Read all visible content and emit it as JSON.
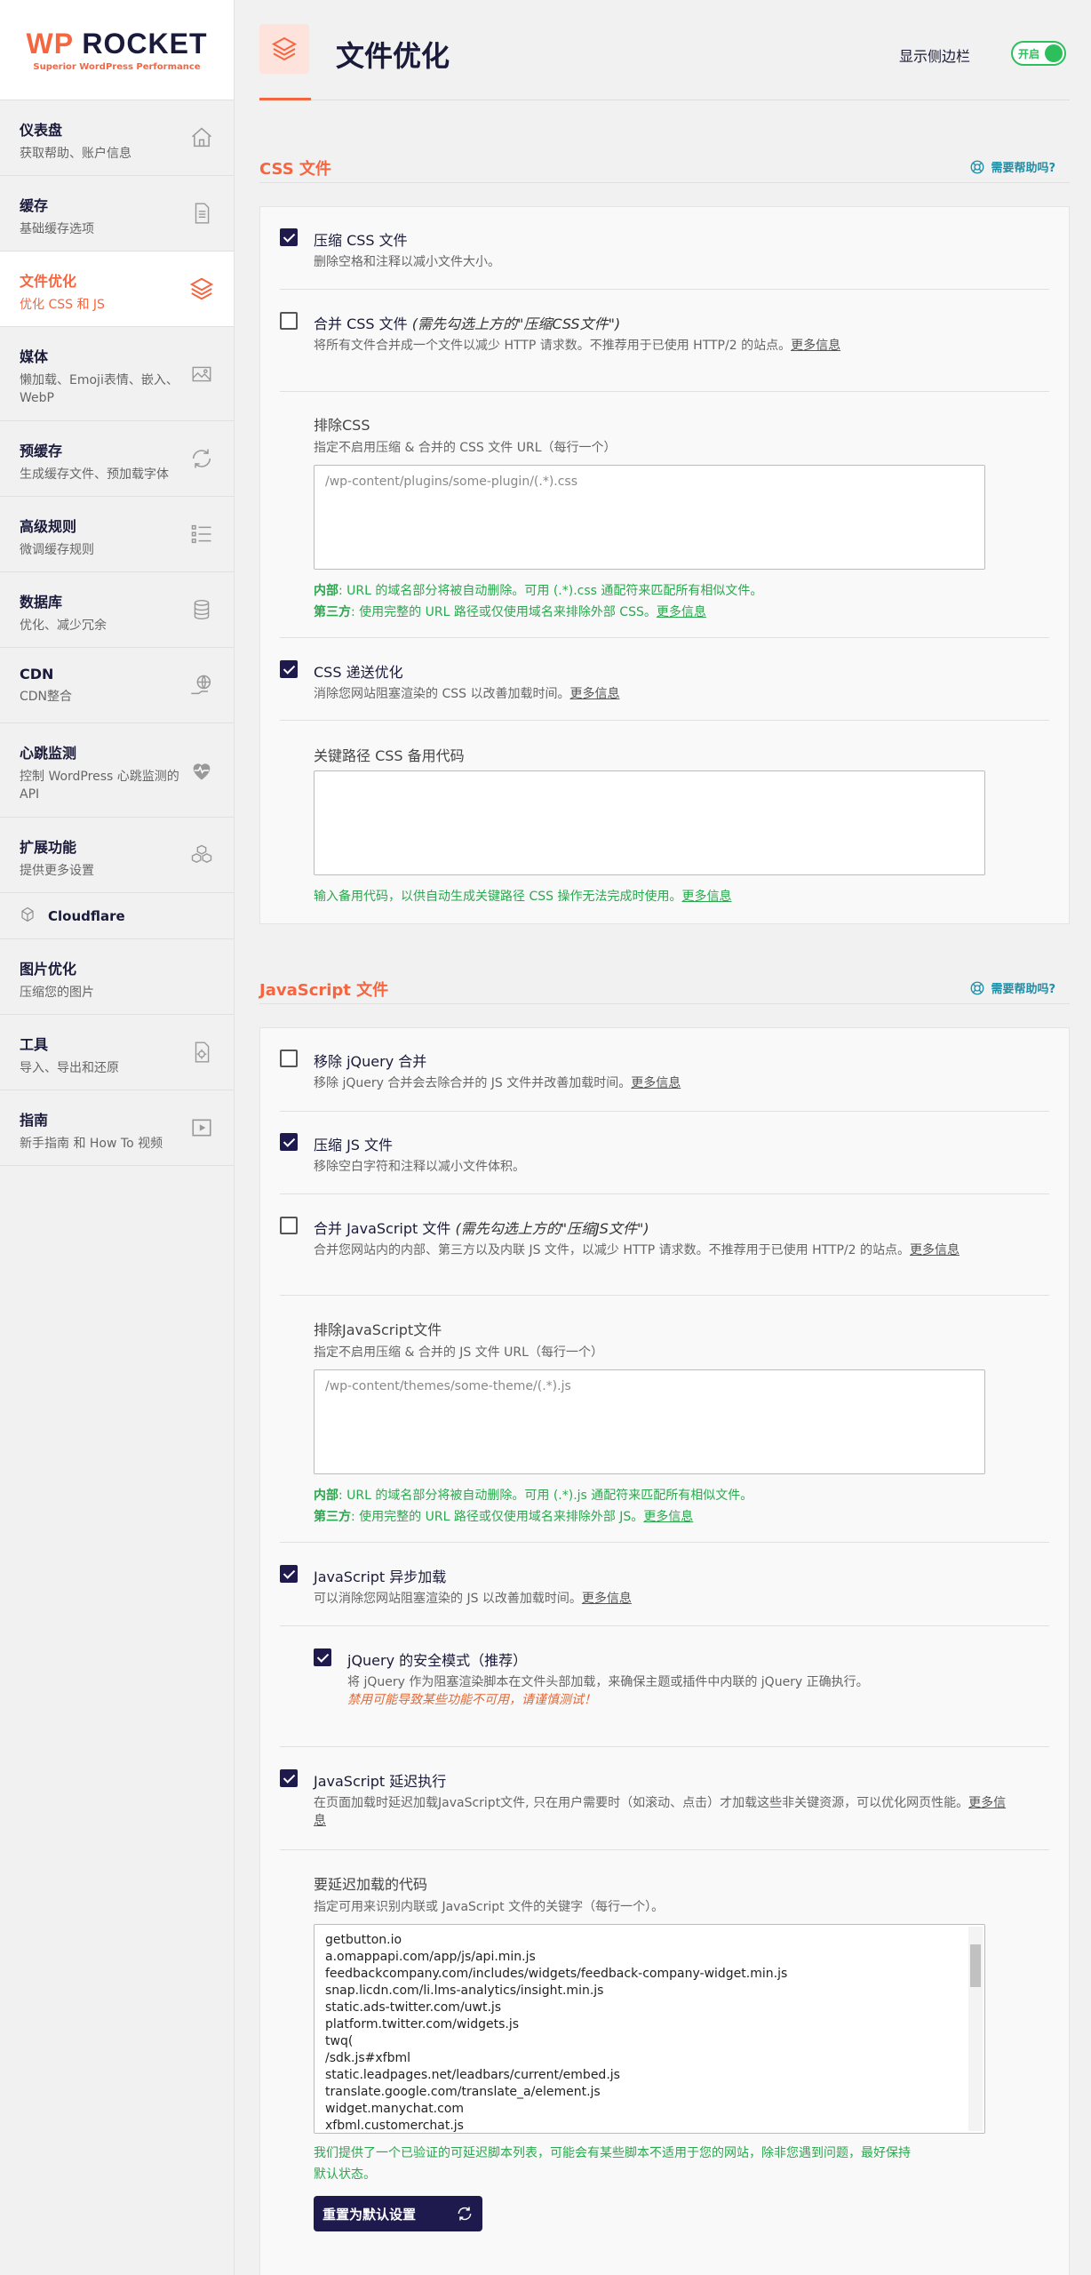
{
  "brand": {
    "name_prefix": "WP",
    "name_suffix": "ROCKET",
    "tagline": "Superior WordPress Performance"
  },
  "sidebar": {
    "items": [
      {
        "title": "仪表盘",
        "sub": "获取帮助、账户信息",
        "icon": "home-icon"
      },
      {
        "title": "缓存",
        "sub": "基础缓存选项",
        "icon": "document-icon"
      },
      {
        "title": "文件优化",
        "sub": "优化 CSS 和 JS",
        "icon": "layers-icon"
      },
      {
        "title": "媒体",
        "sub": "懒加载、Emoji表情、嵌入、WebP",
        "icon": "image-icon"
      },
      {
        "title": "预缓存",
        "sub": "生成缓存文件、预加载字体",
        "icon": "refresh-icon"
      },
      {
        "title": "高级规则",
        "sub": "微调缓存规则",
        "icon": "list-icon"
      },
      {
        "title": "数据库",
        "sub": "优化、减少冗余",
        "icon": "database-icon"
      },
      {
        "title": "CDN",
        "sub": "CDN整合",
        "icon": "cdn-icon"
      },
      {
        "title": "心跳监测",
        "sub": "控制 WordPress 心跳监测的 API",
        "icon": "heart-icon"
      },
      {
        "title": "扩展功能",
        "sub": "提供更多设置",
        "icon": "cubes-icon"
      },
      {
        "title": "Cloudflare",
        "sub": "",
        "icon": "cloudflare-icon"
      },
      {
        "title": "图片优化",
        "sub": "压缩您的图片",
        "icon": ""
      },
      {
        "title": "工具",
        "sub": "导入、导出和还原",
        "icon": "tools-icon"
      },
      {
        "title": "指南",
        "sub": "新手指南 和 How To 视频",
        "icon": "video-icon"
      }
    ]
  },
  "header": {
    "title": "文件优化",
    "show_sidebar_label": "显示侧边栏",
    "toggle_label": "开启"
  },
  "help_label": "需要帮助吗?",
  "more_info": "更多信息",
  "css": {
    "section_title": "CSS 文件",
    "minify": {
      "label": "压缩 CSS 文件",
      "desc": "删除空格和注释以减小文件大小。",
      "checked": true
    },
    "combine": {
      "label": "合并 CSS 文件",
      "label_note": "(需先勾选上方的\"压缩CSS文件\")",
      "desc": "将所有文件合并成一个文件以减少 HTTP 请求数。不推荐用于已使用 HTTP/2 的站点。",
      "checked": false
    },
    "exclude": {
      "label": "排除CSS",
      "hint": "指定不启用压缩 & 合并的 CSS 文件 URL（每行一个）",
      "placeholder": "/wp-content/plugins/some-plugin/(.*).css"
    },
    "note_internal_prefix": "内部",
    "note_internal": ": URL 的域名部分将被自动删除。可用 (.*).css 通配符来匹配所有相似文件。",
    "note_third_prefix": "第三方",
    "note_third": ": 使用完整的 URL 路径或仅使用域名来排除外部 CSS。",
    "async": {
      "label": "CSS 递送优化",
      "desc": "消除您网站阻塞渲染的 CSS 以改善加载时间。",
      "checked": true
    },
    "fallback": {
      "label": "关键路径 CSS 备用代码",
      "note": "输入备用代码，以供自动生成关键路径 CSS 操作无法完成时使用。"
    }
  },
  "js": {
    "section_title": "JavaScript 文件",
    "remove_jquery": {
      "label": "移除 jQuery 合并",
      "desc": "移除 jQuery 合并会去除合并的 JS 文件并改善加载时间。",
      "checked": false
    },
    "minify": {
      "label": "压缩 JS 文件",
      "desc": "移除空白字符和注释以减小文件体积。",
      "checked": true
    },
    "combine": {
      "label": "合并 JavaScript 文件",
      "label_note": "(需先勾选上方的\"压缩JS文件\")",
      "desc": "合并您网站内的内部、第三方以及内联 JS 文件，以减少 HTTP 请求数。不推荐用于已使用 HTTP/2 的站点。",
      "checked": false
    },
    "exclude": {
      "label": "排除JavaScript文件",
      "hint": "指定不启用压缩 & 合并的 JS 文件 URL（每行一个）",
      "placeholder": "/wp-content/themes/some-theme/(.*).js"
    },
    "note_internal_prefix": "内部",
    "note_internal": ": URL 的域名部分将被自动删除。可用 (.*).js 通配符来匹配所有相似文件。",
    "note_third_prefix": "第三方",
    "note_third": ": 使用完整的 URL 路径或仅使用域名来排除外部 JS。",
    "defer": {
      "label": "JavaScript 异步加载",
      "desc": "可以消除您网站阻塞渲染的 JS 以改善加载时间。",
      "checked": true
    },
    "safe_mode": {
      "label": "jQuery 的安全模式（推荐）",
      "desc": "将 jQuery 作为阻塞渲染脚本在文件头部加载，来确保主题或插件中内联的 jQuery 正确执行。",
      "warn": "禁用可能导致某些功能不可用，请谨慎测试！",
      "checked": true
    },
    "delay": {
      "label": "JavaScript 延迟执行",
      "desc_1": "在页面加载时延迟加载JavaScript文件, 只在用户需要时（如滚动、点击）才加载这些非关键资源，可以优化网页性能。",
      "more": "更多信",
      "desc_2": "息",
      "checked": true
    },
    "delay_list": {
      "label": "要延迟加载的代码",
      "hint": "指定可用来识别内联或 JavaScript 文件的关键字（每行一个）。"
    },
    "delay_lines": [
      "getbutton.io",
      "a.omappapi.com/app/js/api.min.js",
      "feedbackcompany.com/includes/widgets/feedback-company-widget.min.js",
      "snap.licdn.com/li.lms-analytics/insight.min.js",
      "static.ads-twitter.com/uwt.js",
      "platform.twitter.com/widgets.js",
      "twq(",
      "/sdk.js#xfbml",
      "static.leadpages.net/leadbars/current/embed.js",
      "translate.google.com/translate_a/element.js",
      "widget.manychat.com",
      "xfbml.customerchat.js"
    ],
    "delay_note_1": "我们提供了一个已验证的可延迟脚本列表，可能会有某些脚本不适用于您的网站，除非您遇到问题，最好保持",
    "delay_note_2": "默认状态。",
    "reset_button": "重置为默认设置"
  }
}
